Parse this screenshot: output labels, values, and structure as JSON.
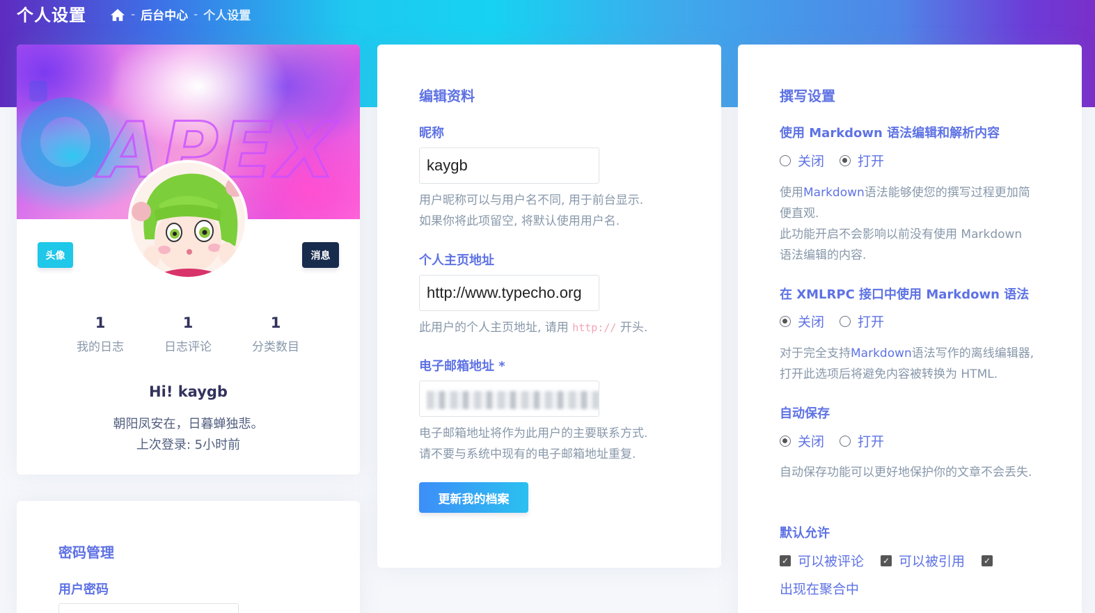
{
  "header": {
    "title": "个人设置",
    "breadcrumb": [
      "后台中心",
      "个人设置"
    ],
    "separator": "-"
  },
  "profile": {
    "cover_text": "APEX",
    "avatar_button": "头像",
    "message_button": "消息",
    "stats": [
      {
        "value": "1",
        "label": "我的日志"
      },
      {
        "value": "1",
        "label": "日志评论"
      },
      {
        "value": "1",
        "label": "分类数目"
      }
    ],
    "greeting": "Hi! kaygb",
    "motto": "朝阳凤安在，日暮蝉独悲。",
    "last_login": "上次登录: 5小时前"
  },
  "password": {
    "title": "密码管理",
    "field_label": "用户密码"
  },
  "edit_profile": {
    "title": "编辑资料",
    "nickname": {
      "label": "昵称",
      "value": "kaygb",
      "help1": "用户昵称可以与用户名不同, 用于前台显示.",
      "help2": "如果你将此项留空, 将默认使用用户名."
    },
    "homepage": {
      "label": "个人主页地址",
      "value": "http://www.typecho.org",
      "help_prefix": "此用户的个人主页地址, 请用",
      "help_code": "http://",
      "help_suffix": "开头."
    },
    "email": {
      "label": "电子邮箱地址",
      "required_mark": "*",
      "help1": "电子邮箱地址将作为此用户的主要联系方式.",
      "help2": "请不要与系统中现有的电子邮箱地址重复."
    },
    "submit": "更新我的档案"
  },
  "writing": {
    "title": "撰写设置",
    "markdown": {
      "label": "使用 Markdown 语法编辑和解析内容",
      "off": "关闭",
      "on": "打开",
      "selected": "on",
      "help_a": "使用",
      "help_hl": "Markdown",
      "help_b": "语法能够使您的撰写过程更加简便直观.",
      "help2": "此功能开启不会影响以前没有使用 Markdown 语法编辑的内容."
    },
    "xmlrpc": {
      "label": "在 XMLRPC 接口中使用 Markdown 语法",
      "off": "关闭",
      "on": "打开",
      "selected": "off",
      "help_a": "对于完全支持",
      "help_hl": "Markdown",
      "help_b": "语法写作的离线编辑器, 打开此选项后将避免内容被转换为 HTML."
    },
    "autosave": {
      "label": "自动保存",
      "off": "关闭",
      "on": "打开",
      "selected": "off",
      "help": "自动保存功能可以更好地保护你的文章不会丢失."
    },
    "defaults": {
      "label": "默认允许",
      "options": [
        "可以被评论",
        "可以被引用",
        "出现在聚合中"
      ]
    }
  }
}
